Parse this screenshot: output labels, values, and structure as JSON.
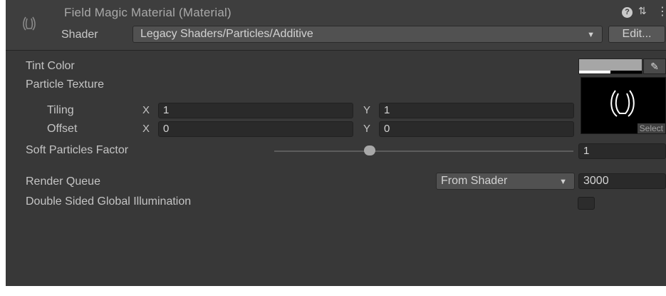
{
  "header": {
    "title": "Field Magic Material (Material)",
    "shader_label": "Shader",
    "shader_value": "Legacy Shaders/Particles/Additive",
    "edit_label": "Edit...",
    "icons": [
      "material-icon",
      "help-icon",
      "preset-icon",
      "kebab-menu-icon"
    ]
  },
  "properties": {
    "tint_color": {
      "label": "Tint Color",
      "color": "#a6a6a6",
      "alpha_fraction": 0.5
    },
    "particle_texture": {
      "label": "Particle Texture",
      "select_label": "Select"
    },
    "tiling": {
      "label": "Tiling",
      "x_axis": "X",
      "x": "1",
      "y_axis": "Y",
      "y": "1"
    },
    "offset": {
      "label": "Offset",
      "x_axis": "X",
      "x": "0",
      "y_axis": "Y",
      "y": "0"
    },
    "soft_particles": {
      "label": "Soft Particles Factor",
      "value": "1",
      "slider_fraction": 0.32
    },
    "render_queue": {
      "label": "Render Queue",
      "mode": "From Shader",
      "value": "3000"
    },
    "double_sided_gi": {
      "label": "Double Sided Global Illumination",
      "checked": false
    }
  },
  "glyphs": {
    "arrow": "▼",
    "help": "?",
    "preset": "⇅",
    "menu": "⋮",
    "picker": "✎"
  }
}
